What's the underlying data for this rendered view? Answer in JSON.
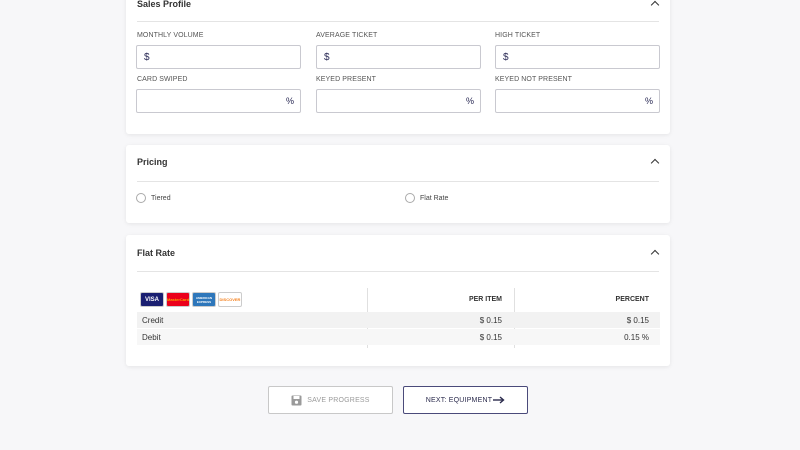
{
  "sales_profile": {
    "title": "Sales Profile",
    "fields": [
      {
        "label": "MONTHLY VOLUME",
        "prefix": "$",
        "suffix": "",
        "value": ""
      },
      {
        "label": "AVERAGE TICKET",
        "prefix": "$",
        "suffix": "",
        "value": ""
      },
      {
        "label": "HIGH TICKET",
        "prefix": "$",
        "suffix": "",
        "value": ""
      },
      {
        "label": "CARD SWIPED",
        "prefix": "",
        "suffix": "%",
        "value": ""
      },
      {
        "label": "KEYED PRESENT",
        "prefix": "",
        "suffix": "%",
        "value": ""
      },
      {
        "label": "KEYED NOT PRESENT",
        "prefix": "",
        "suffix": "%",
        "value": ""
      }
    ]
  },
  "pricing": {
    "title": "Pricing",
    "options": [
      {
        "label": "Tiered",
        "selected": false
      },
      {
        "label": "Flat Rate",
        "selected": false
      }
    ]
  },
  "flat_rate": {
    "title": "Flat Rate",
    "card_logos": [
      {
        "label": "VISA",
        "bg": "#1a1f71",
        "fg": "#ffffff"
      },
      {
        "label": "MasterCard",
        "bg": "#eb001b",
        "fg": "#f9a000"
      },
      {
        "label": "AMERICAN EXPRESS",
        "bg": "#2e77bb",
        "fg": "#ffffff"
      },
      {
        "label": "DISCOVER",
        "bg": "#ffffff",
        "fg": "#f58220"
      }
    ],
    "columns": [
      "PER ITEM",
      "PERCENT"
    ],
    "rows": [
      {
        "name": "Credit",
        "per_item": "$ 0.15",
        "percent": "$ 0.15"
      },
      {
        "name": "Debit",
        "per_item": "$ 0.15",
        "percent": "0.15 %"
      }
    ]
  },
  "buttons": {
    "save": "SAVE PROGRESS",
    "next": "NEXT: EQUIPMENT"
  },
  "colors": {
    "accent": "#2b2b4d",
    "row_shade": "#f2f2f2"
  }
}
